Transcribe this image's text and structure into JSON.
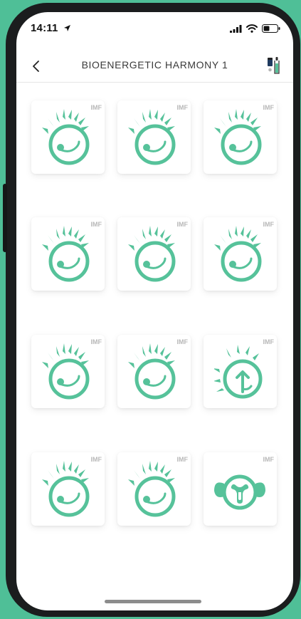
{
  "status_bar": {
    "time": "14:11",
    "location_icon": "location-arrow-icon",
    "signal_icon": "cellular-signal-icon",
    "wifi_icon": "wifi-icon",
    "battery_icon": "battery-icon"
  },
  "header": {
    "back_icon": "chevron-left-icon",
    "title": "BIOENERGETIC HARMONY 1",
    "action_icon": "device-pair-icon"
  },
  "tiles": [
    {
      "badge": "IMF",
      "icon": "sun-sprout-icon"
    },
    {
      "badge": "IMF",
      "icon": "sun-sprout-icon"
    },
    {
      "badge": "IMF",
      "icon": "sun-sprout-icon"
    },
    {
      "badge": "IMF",
      "icon": "sun-sprout-icon"
    },
    {
      "badge": "IMF",
      "icon": "sun-sprout-icon"
    },
    {
      "badge": "IMF",
      "icon": "sun-sprout-icon"
    },
    {
      "badge": "IMF",
      "icon": "sun-sprout-icon"
    },
    {
      "badge": "IMF",
      "icon": "sun-sprout-icon"
    },
    {
      "badge": "IMF",
      "icon": "sunrise-arrow-icon"
    },
    {
      "badge": "IMF",
      "icon": "sun-sprout-icon"
    },
    {
      "badge": "IMF",
      "icon": "sun-sprout-icon"
    },
    {
      "badge": "IMF",
      "icon": "uterus-ribbon-icon"
    }
  ],
  "colors": {
    "accent": "#56c29a",
    "background": "#4fbf97",
    "badge": "#b8b8b8"
  }
}
